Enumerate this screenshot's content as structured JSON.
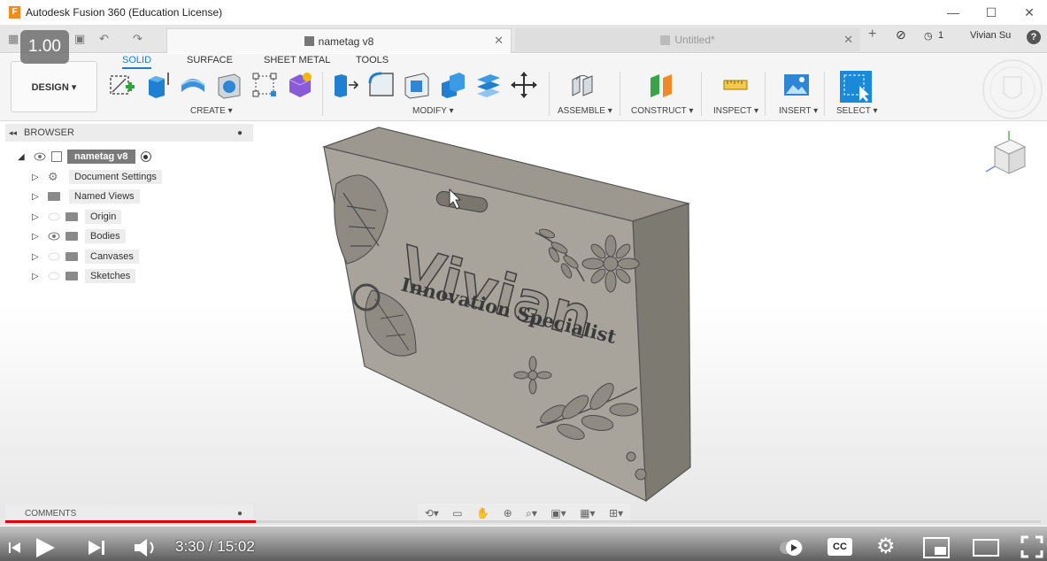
{
  "window": {
    "title": "Autodesk Fusion 360 (Education License)",
    "logo_letter": "F",
    "minimize": "—",
    "maximize": "☐",
    "close": "✕"
  },
  "tabs": {
    "active": "nametag v8",
    "inactive": "Untitled*",
    "close_glyph": "✕",
    "new_tab_glyph": "+",
    "job_count": "1",
    "user": "Vivian Su",
    "help": "?"
  },
  "video": {
    "speed": "1.00",
    "time": "3:30 / 15:02",
    "cc": "CC",
    "progress_fraction": 0.242
  },
  "ribbon": {
    "workspace": "DESIGN ▾",
    "tabs": [
      "SOLID",
      "SURFACE",
      "SHEET METAL",
      "TOOLS"
    ],
    "groups": {
      "create": "CREATE ▾",
      "modify": "MODIFY ▾",
      "assemble": "ASSEMBLE ▾",
      "construct": "CONSTRUCT ▾",
      "inspect": "INSPECT ▾",
      "insert": "INSERT ▾",
      "select": "SELECT ▾"
    }
  },
  "browser": {
    "title": "BROWSER",
    "root": "nametag v8",
    "items": [
      "Document Settings",
      "Named Views",
      "Origin",
      "Bodies",
      "Canvases",
      "Sketches"
    ]
  },
  "comments": {
    "title": "COMMENTS"
  },
  "model": {
    "name_text": "Vivian",
    "subtitle_text": "Innovation Specialist"
  },
  "colors": {
    "accent": "#1a7fd4",
    "progress": "#e00000",
    "model_face": "#a8a49c"
  }
}
